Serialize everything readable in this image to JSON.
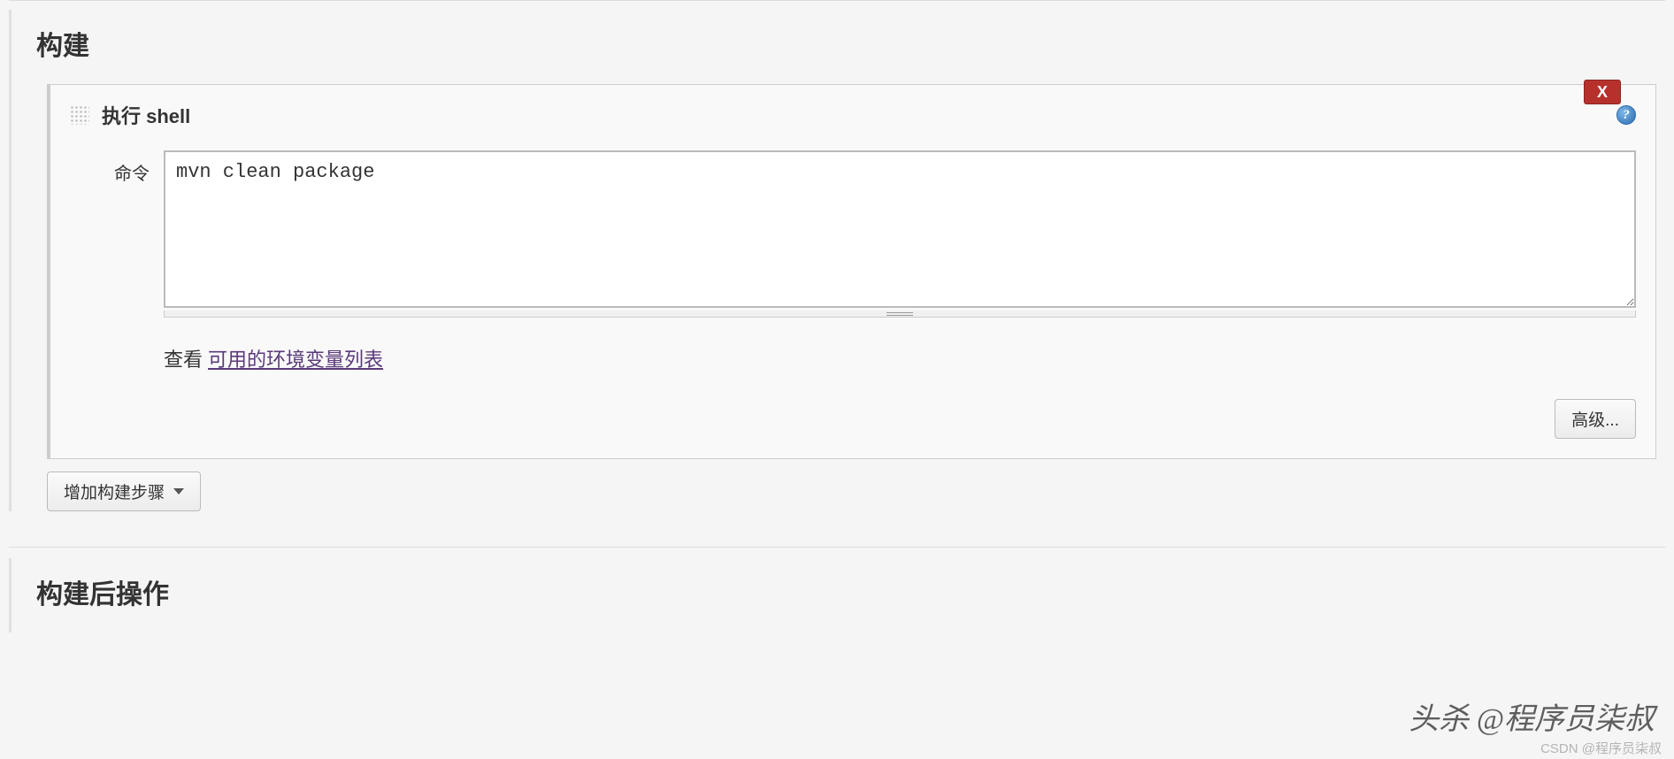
{
  "sections": {
    "build": {
      "title": "构建",
      "step": {
        "title": "执行 shell",
        "delete_label": "X",
        "help_symbol": "?",
        "command_label": "命令",
        "command_value": "mvn clean package",
        "hint_prefix": "查看 ",
        "hint_link": "可用的环境变量列表",
        "advanced_label": "高级..."
      },
      "add_step_label": "增加构建步骤"
    },
    "post_build": {
      "title": "构建后操作"
    }
  },
  "watermark": {
    "main": "头杀 @程序员柒叔",
    "sub": "CSDN @程序员柒叔"
  }
}
